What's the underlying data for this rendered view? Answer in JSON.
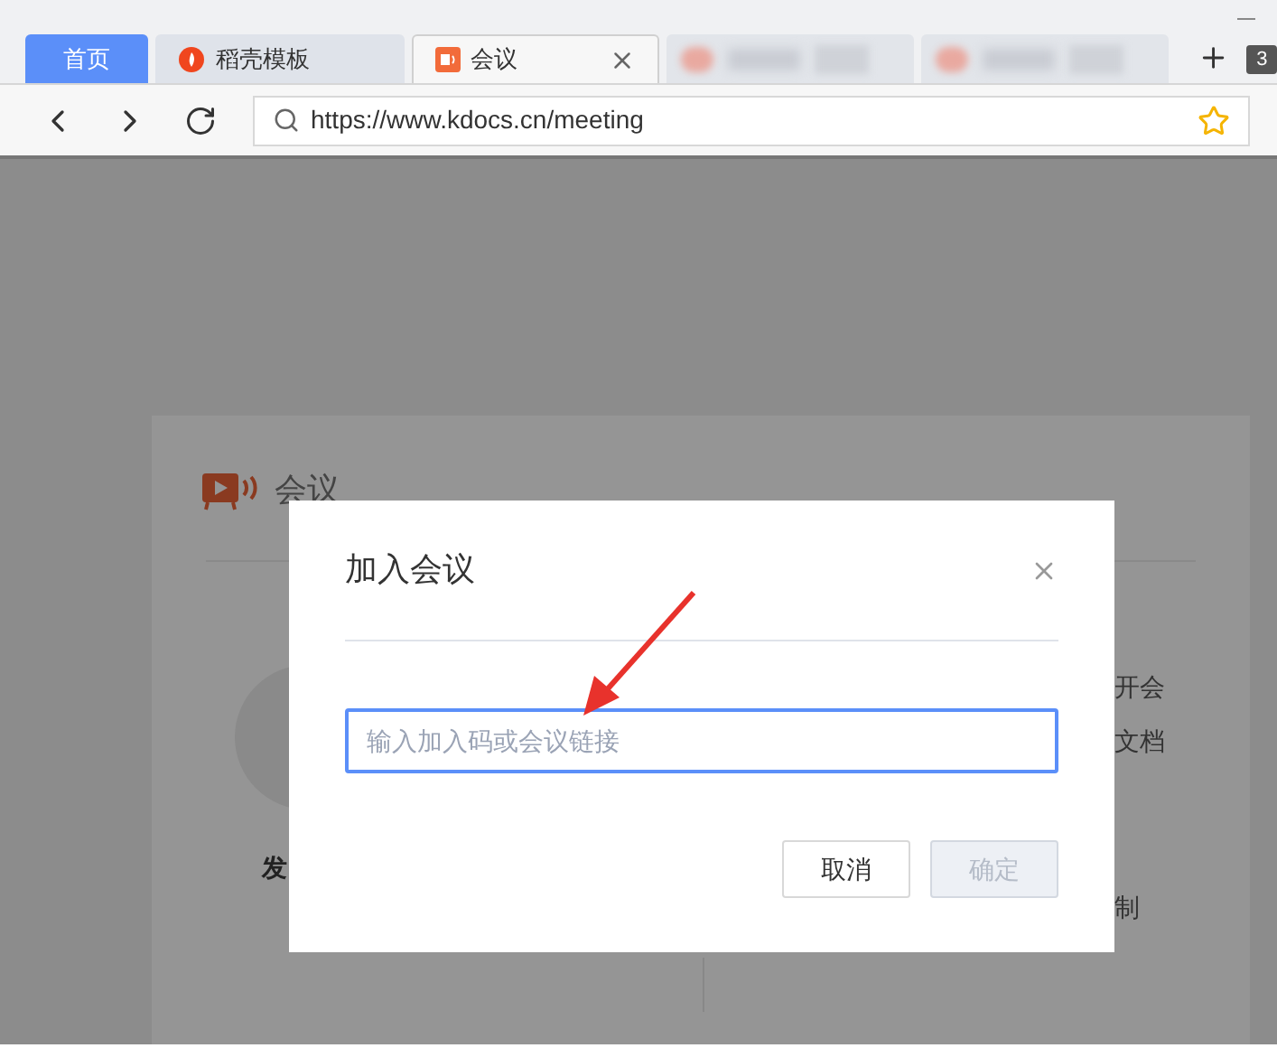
{
  "browser": {
    "tabs": [
      {
        "label": "首页",
        "kind": "home",
        "selected": false
      },
      {
        "label": "稻壳模板",
        "kind": "page",
        "selected": false
      },
      {
        "label": "会议",
        "kind": "page",
        "selected": true
      },
      {
        "kind": "blurred"
      },
      {
        "kind": "blurred"
      }
    ],
    "tab_count": "3",
    "address": "https://www.kdocs.cn/meeting"
  },
  "page": {
    "title": "会议",
    "fragments": [
      "开会",
      "文档",
      "发",
      "制"
    ]
  },
  "dialog": {
    "title": "加入会议",
    "input": {
      "placeholder": "输入加入码或会议链接"
    },
    "buttons": [
      {
        "label": "取消",
        "disabled": false
      },
      {
        "label": "确定",
        "disabled": true
      }
    ]
  }
}
